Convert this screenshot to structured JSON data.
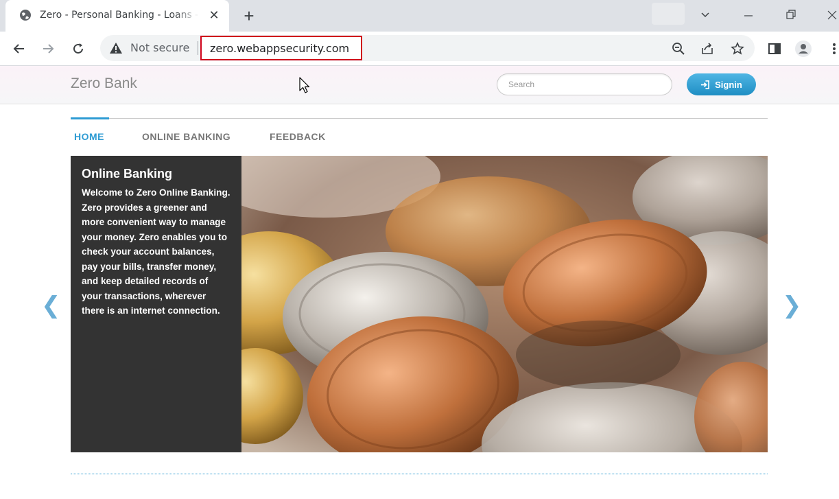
{
  "browser": {
    "tab_title": "Zero - Personal Banking - Loans - Credit Cards",
    "tab_close": "✕",
    "new_tab": "+",
    "security_label": "Not secure",
    "url": "zero.webappsecurity.com",
    "window_controls": {
      "tab_search": "⌄",
      "minimize": "—",
      "restore": "❐",
      "close": "✕"
    },
    "icons": [
      "globe-icon",
      "back-icon",
      "forward-icon",
      "reload-icon",
      "warning-icon",
      "zoom-icon",
      "share-icon",
      "star-icon",
      "side-panel-icon",
      "profile-icon",
      "menu-icon"
    ]
  },
  "header": {
    "brand": "Zero Bank",
    "search_placeholder": "Search",
    "signin_label": "Signin"
  },
  "nav": {
    "items": [
      {
        "label": "HOME",
        "active": true
      },
      {
        "label": "ONLINE BANKING",
        "active": false
      },
      {
        "label": "FEEDBACK",
        "active": false
      }
    ]
  },
  "carousel": {
    "title": "Online Banking",
    "text": "Welcome to Zero Online Banking. Zero provides a greener and more convenient way to manage your money. Zero enables you to check your account balances, pay your bills, transfer money, and keep detailed records of your transactions, wherever there is an internet connection.",
    "prev": "❮",
    "next": "❯",
    "image": "coins-photo"
  },
  "colors": {
    "accent": "#2d9bd3",
    "caption_bg": "#333333",
    "url_highlight": "#d0021b"
  }
}
